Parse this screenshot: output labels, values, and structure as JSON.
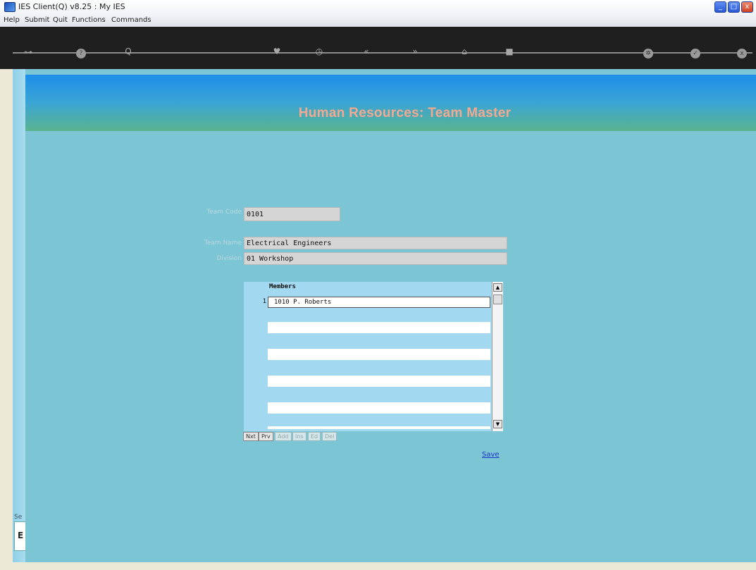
{
  "window": {
    "title": "IES Client(Q) v8.25 : My IES",
    "controls": {
      "minimize": "_",
      "maximize": "□",
      "close": "x"
    }
  },
  "menu": [
    "Help",
    "Submit",
    "Quit",
    "Functions",
    "Commands"
  ],
  "toolbar": {
    "icons": [
      "key-icon",
      "help-icon",
      "search-icon",
      "heart-icon",
      "clock-icon",
      "rewind-icon",
      "forward-icon",
      "bookmark-icon",
      "stop-icon",
      "settings-icon",
      "ok-icon",
      "close-icon"
    ],
    "glyphs": {
      "help": "?",
      "search": "Q",
      "heart": "♥",
      "clock": "◷",
      "rewind": "«",
      "forward": "»",
      "bookmark": "⌂",
      "stop": "■",
      "settings": "✲",
      "ok": "✓",
      "close": "x"
    }
  },
  "page": {
    "title": "Human Resources: Team Master"
  },
  "form": {
    "team_code_label": "Team Code",
    "team_code_value": "0101",
    "team_name_label": "Team Name",
    "team_name_value": "Electrical Engineers",
    "division_label": "Division",
    "division_value": "01 Workshop"
  },
  "members": {
    "header": "Members",
    "rows": [
      {
        "num": "1",
        "value": "1010 P. Roberts"
      }
    ],
    "scroll_up": "▲",
    "scroll_down": "▼"
  },
  "grid_buttons": [
    "Nxt",
    "Prv",
    "Add",
    "Ins",
    "Ed",
    "Del"
  ],
  "save_label": "Save",
  "left_rail": {
    "text": "Se",
    "letter": "E"
  }
}
